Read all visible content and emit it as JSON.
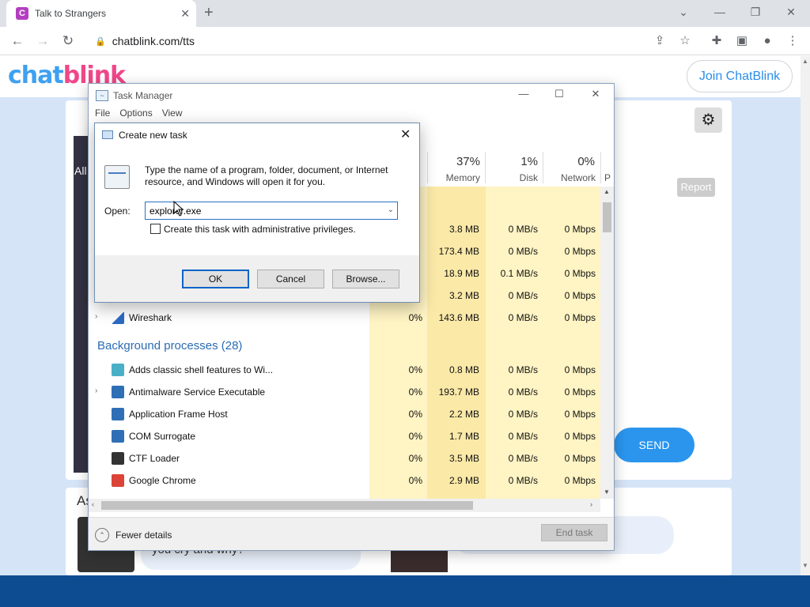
{
  "browser": {
    "tab_title": "Talk to Strangers",
    "tab_favicon": "C",
    "url": "chatblink.com/tts",
    "new_tab_symbol": "+",
    "close_tab_symbol": "✕"
  },
  "site": {
    "logo_part1": "chat",
    "logo_part2": "blink",
    "join_button": "Join ChatBlink",
    "report_button": "Report",
    "send_button": "SEND",
    "left_tab_partial": "All",
    "bottom_partial": "As",
    "chat_bubble_text": "you cry and why?",
    "colors": {
      "logo_blue": "#3ea0f0",
      "logo_pink": "#f0478a",
      "send_blue": "#2b95ee",
      "footer": "#0e4c92"
    }
  },
  "task_manager": {
    "title": "Task Manager",
    "menu": [
      "File",
      "Options",
      "View"
    ],
    "columns": [
      {
        "pct": "37%",
        "label": "Memory"
      },
      {
        "pct": "1%",
        "label": "Disk"
      },
      {
        "pct": "0%",
        "label": "Network"
      },
      {
        "pct": "",
        "label": "P"
      }
    ],
    "partial_rows": [
      {
        "memory": "3.8 MB",
        "disk": "0 MB/s",
        "network": "0 Mbps"
      },
      {
        "memory": "173.4 MB",
        "disk": "0 MB/s",
        "network": "0 Mbps"
      },
      {
        "memory": "18.9 MB",
        "disk": "0.1 MB/s",
        "network": "0 Mbps"
      },
      {
        "memory": "3.2 MB",
        "disk": "0 MB/s",
        "network": "0 Mbps"
      }
    ],
    "wireshark": {
      "name": "Wireshark",
      "cpu": "0%",
      "memory": "143.6 MB",
      "disk": "0 MB/s",
      "network": "0 Mbps"
    },
    "background_header": "Background processes (28)",
    "background": [
      {
        "name": "Adds classic shell features to Wi...",
        "cpu": "0%",
        "memory": "0.8 MB",
        "disk": "0 MB/s",
        "network": "0 Mbps",
        "icon_color": "#4ab0c8",
        "expandable": false
      },
      {
        "name": "Antimalware Service Executable",
        "cpu": "0%",
        "memory": "193.7 MB",
        "disk": "0 MB/s",
        "network": "0 Mbps",
        "icon_color": "#2f6fb5",
        "expandable": true
      },
      {
        "name": "Application Frame Host",
        "cpu": "0%",
        "memory": "2.2 MB",
        "disk": "0 MB/s",
        "network": "0 Mbps",
        "icon_color": "#2f6fb5",
        "expandable": false
      },
      {
        "name": "COM Surrogate",
        "cpu": "0%",
        "memory": "1.7 MB",
        "disk": "0 MB/s",
        "network": "0 Mbps",
        "icon_color": "#2f6fb5",
        "expandable": false
      },
      {
        "name": "CTF Loader",
        "cpu": "0%",
        "memory": "3.5 MB",
        "disk": "0 MB/s",
        "network": "0 Mbps",
        "icon_color": "#333333",
        "expandable": false
      },
      {
        "name": "Google Chrome",
        "cpu": "0%",
        "memory": "2.9 MB",
        "disk": "0 MB/s",
        "network": "0 Mbps",
        "icon_color": "#db4437",
        "expandable": false
      }
    ],
    "fewer_details": "Fewer details",
    "end_task": "End task"
  },
  "run_dialog": {
    "title": "Create new task",
    "description": "Type the name of a program, folder, document, or Internet resource, and Windows will open it for you.",
    "open_label": "Open:",
    "open_value": "explorer.exe",
    "admin_checkbox_label": "Create this task with administrative privileges.",
    "ok": "OK",
    "cancel": "Cancel",
    "browse": "Browse..."
  }
}
